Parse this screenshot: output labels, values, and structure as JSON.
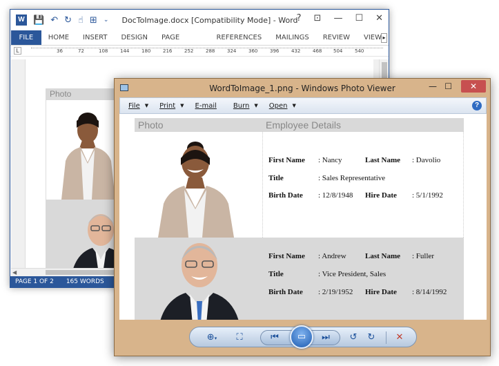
{
  "word": {
    "app_icon": "W",
    "title": "DocToImage.docx [Compatibility Mode] - Word",
    "controls": {
      "help": "?",
      "ribbon_display": "⊡",
      "minimize": "—",
      "maximize": "☐",
      "close": "✕"
    },
    "file_tab": "FILE",
    "tabs": [
      "HOME",
      "INSERT",
      "DESIGN",
      "PAGE LAYOUT",
      "REFERENCES",
      "MAILINGS",
      "REVIEW",
      "VIEW"
    ],
    "ribbon_scroll": "▸",
    "ruler_ticks": [
      "36",
      "72",
      "108",
      "144",
      "180",
      "216",
      "252",
      "288",
      "324",
      "360",
      "396",
      "432",
      "468",
      "504",
      "540"
    ],
    "table_header": "Photo",
    "status": {
      "page": "PAGE 1 OF 2",
      "words": "165 WORDS"
    }
  },
  "viewer": {
    "title": "WordToImage_1.png - Windows Photo Viewer",
    "controls": {
      "minimize": "—",
      "maximize": "☐",
      "close": "✕"
    },
    "menu": [
      {
        "label": "File",
        "arrow": "▼"
      },
      {
        "label": "Print",
        "arrow": "▼"
      },
      {
        "label": "E-mail",
        "arrow": ""
      },
      {
        "label": "Burn",
        "arrow": "▼"
      },
      {
        "label": "Open",
        "arrow": "▼"
      }
    ],
    "help": "?",
    "image": {
      "header": {
        "photo": "Photo",
        "details": "Employee Details"
      },
      "employees": [
        {
          "first_name_label": "First Name",
          "first_name": ": Nancy",
          "last_name_label": "Last Name",
          "last_name": ": Davolio",
          "title_label": "Title",
          "title": ": Sales Representative",
          "birth_label": "Birth Date",
          "birth": ": 12/8/1948",
          "hire_label": "Hire Date",
          "hire": ": 5/1/1992"
        },
        {
          "first_name_label": "First Name",
          "first_name": ": Andrew",
          "last_name_label": "Last Name",
          "last_name": ": Fuller",
          "title_label": "Title",
          "title": ": Vice President, Sales",
          "birth_label": "Birth Date",
          "birth": ": 2/19/1952",
          "hire_label": "Hire Date",
          "hire": ": 8/14/1992"
        }
      ]
    },
    "toolbar_icons": [
      "zoom-icon",
      "actual-size-icon",
      "previous-icon",
      "slideshow-icon",
      "next-icon",
      "rotate-left-icon",
      "rotate-right-icon",
      "delete-icon"
    ]
  }
}
